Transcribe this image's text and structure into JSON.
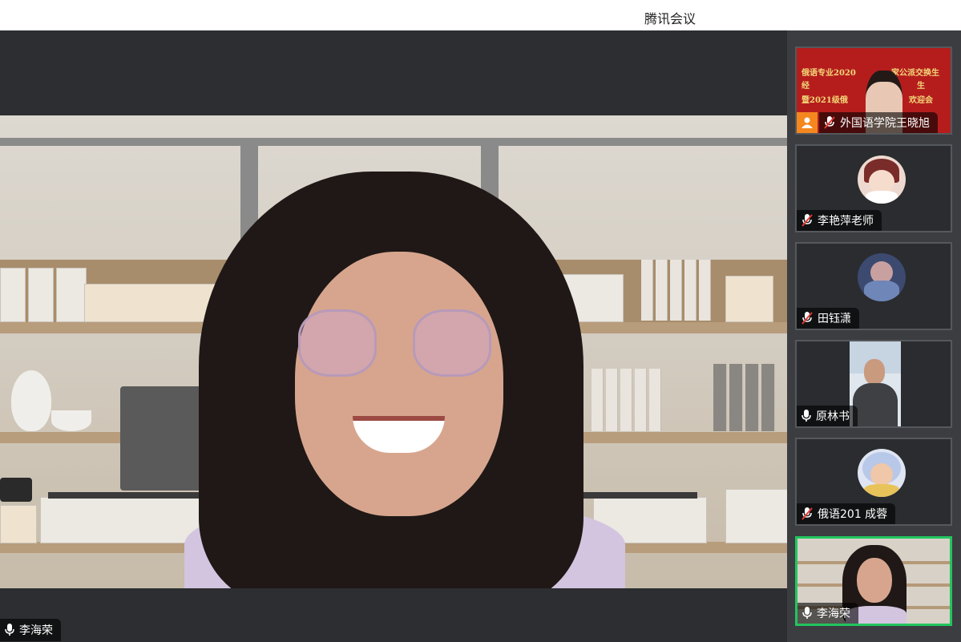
{
  "window": {
    "title": "腾讯会议"
  },
  "main_speaker": {
    "name": "李海荣",
    "mic": "on"
  },
  "participants": [
    {
      "name": "外国语学院王晓旭",
      "mic": "muted",
      "banner_lines": [
        "俄语专业2020",
        "家公派交换生",
        "经",
        "暨2021级俄",
        "生",
        "欢迎会"
      ],
      "icon": "person-icon"
    },
    {
      "name": "李艳萍老师",
      "mic": "muted",
      "avatar": "cartoon-girl-avatar"
    },
    {
      "name": "田钰潇",
      "mic": "muted",
      "avatar": "illustration-avatar"
    },
    {
      "name": "原林书",
      "mic": "on",
      "avatar": "video-man"
    },
    {
      "name": "俄语201 成蓉",
      "mic": "muted",
      "avatar": "child-avatar"
    },
    {
      "name": "李海荣",
      "mic": "on",
      "active": true,
      "avatar": "video-woman"
    }
  ],
  "colors": {
    "active_border": "#22c55e",
    "main_bg": "#2c2e31",
    "sidebar_bg": "#3b3d41",
    "muted_red": "#e53935"
  }
}
